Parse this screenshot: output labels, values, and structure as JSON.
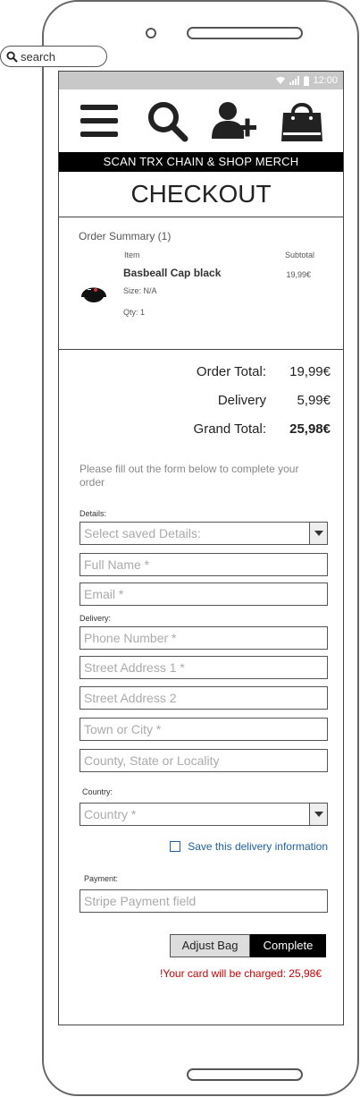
{
  "search": {
    "label": "search"
  },
  "status": {
    "time": "12:00"
  },
  "banner": {
    "text": "SCAN TRX CHAIN & SHOP MERCH"
  },
  "page": {
    "title": "CHECKOUT"
  },
  "summary": {
    "title": "Order Summary (1)",
    "col_item": "Item",
    "col_subtotal": "Subtotal",
    "item": {
      "name": "Basbeall Cap black",
      "size": "Size: N/A",
      "qty": "Qty: 1",
      "subtotal": "19,99€"
    }
  },
  "totals": [
    {
      "label": "Order Total:",
      "value": "19,99€"
    },
    {
      "label": "Delivery",
      "value": "5,99€"
    },
    {
      "label": "Grand Total:",
      "value": "25,98€"
    }
  ],
  "form": {
    "instructions": "Please fill out the form below to complete your order",
    "details_label": "Details:",
    "saved_details_placeholder": "Select saved Details:",
    "full_name_placeholder": "Full Name *",
    "email_placeholder": "Email *",
    "delivery_label": "Delivery:",
    "phone_placeholder": "Phone Number *",
    "street1_placeholder": "Street Address 1 *",
    "street2_placeholder": "Street Address 2",
    "town_placeholder": "Town or City *",
    "county_placeholder": "County, State or Locality",
    "country_label": "Country:",
    "country_placeholder": "Country *",
    "save_info_label": "Save this delivery information",
    "payment_label": "Payment:",
    "payment_placeholder": "Stripe Payment field"
  },
  "actions": {
    "adjust_label": "Adjust Bag",
    "complete_label": "Complete",
    "charge_note": "!Your card will be charged: 25,98€"
  },
  "icons": {
    "menu": "menu-icon",
    "search": "search-icon",
    "add_user": "add-user-icon",
    "bag": "shopping-bag-icon"
  },
  "colors": {
    "accent_link": "#1f5fa8",
    "warning": "#cc0000",
    "banner_bg": "#000000"
  }
}
